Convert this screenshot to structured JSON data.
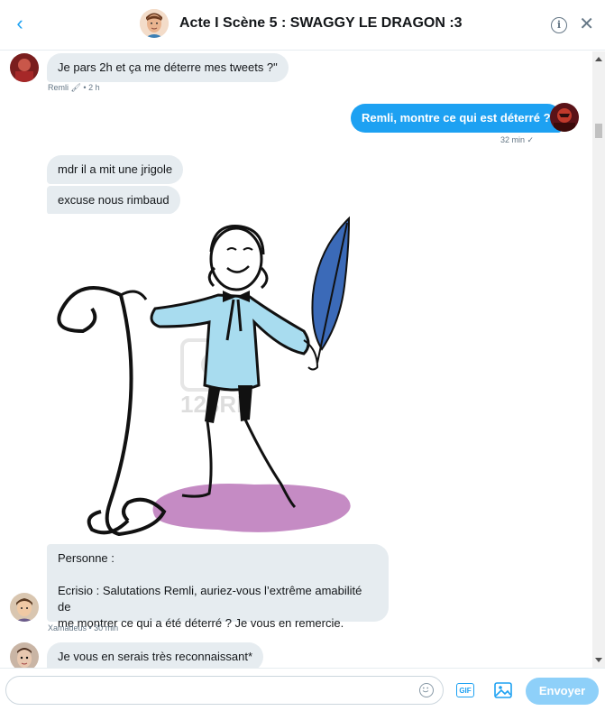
{
  "header": {
    "title": "Acte I Scène 5 : SWAGGY LE DRAGON :3"
  },
  "messages": {
    "m1": {
      "text": "Je pars 2h et ça me déterre mes tweets ?\"",
      "meta": "Remli 🖌 • 2 h"
    },
    "m2": {
      "text": "Remli, montre ce qui est déterré ?",
      "meta": "32 min ✓"
    },
    "m3": {
      "text": "mdr il a mit une jrigole"
    },
    "m4": {
      "text": "excuse nous rimbaud"
    },
    "m5": {
      "line1": "Personne :",
      "line2": "Ecrisio : Salutations Remli, auriez-vous l’extrême amabilité de",
      "line3": "me montrer ce qui a été déterré ? Je vous en remercie.",
      "meta": "Xamadeus • 30 min"
    },
    "m6": {
      "text": "Je vous en serais très reconnaissant*"
    }
  },
  "image": {
    "watermark": "123RF"
  },
  "composer": {
    "placeholder": "",
    "gif_label": "GIF",
    "send_label": "Envoyer"
  },
  "colors": {
    "accent": "#1da1f2",
    "bubble_in": "#e6ecf0",
    "send_disabled": "#8ed0f9"
  }
}
